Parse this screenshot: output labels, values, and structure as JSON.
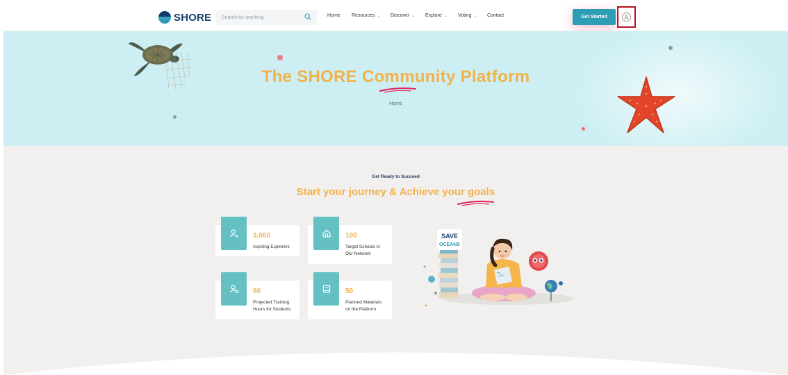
{
  "header": {
    "logo_text": "SHORE",
    "search_placeholder": "Search for anything",
    "menu": [
      {
        "label": "Home",
        "has_dropdown": false
      },
      {
        "label": "Resources",
        "has_dropdown": true
      },
      {
        "label": "Discover",
        "has_dropdown": true
      },
      {
        "label": "Explore",
        "has_dropdown": true
      },
      {
        "label": "Voting",
        "has_dropdown": true
      },
      {
        "label": "Contact",
        "has_dropdown": false
      }
    ],
    "cta_label": "Get Started"
  },
  "hero": {
    "title": "The SHORE Community Platform",
    "breadcrumb": "Home"
  },
  "section": {
    "kicker": "Get Ready to Succeed",
    "title": "Start your journey & Achieve your goals"
  },
  "stats": [
    {
      "value": "3,000",
      "label_lines": [
        "Aspiring Explorers"
      ],
      "icon": "user-star-icon"
    },
    {
      "value": "100",
      "label_lines": [
        "Target Schools in",
        "Our Network"
      ],
      "icon": "home-icon"
    },
    {
      "value": "60",
      "label_lines": [
        "Projected Training",
        "Hours for Students"
      ],
      "icon": "user-search-icon"
    },
    {
      "value": "50",
      "label_lines": [
        "Planned Materials",
        "on the Platform"
      ],
      "icon": "book-icon"
    }
  ],
  "illustration": {
    "sign_text": [
      "SAVE",
      "OCEANS"
    ]
  },
  "colors": {
    "accent_teal": "#2c9db2",
    "stat_icon_bg": "#64c0c3",
    "heading_yellow": "#f2b24b",
    "underline_pink": "#e0245e",
    "hero_bg": "#cdeff3",
    "section_bg": "#f1f0ef",
    "highlight_border": "#b3121f"
  }
}
